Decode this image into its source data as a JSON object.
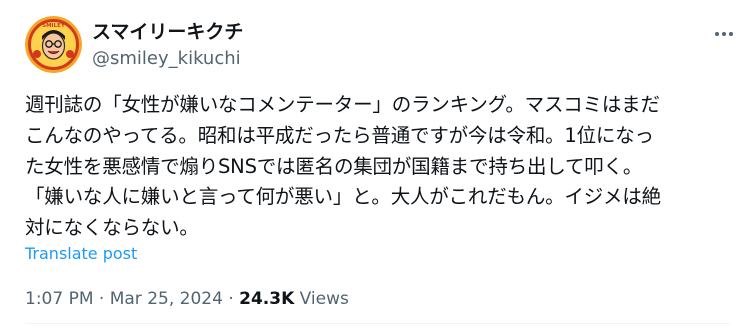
{
  "post": {
    "author_name": "スマイリーキクチ",
    "author_handle": "@smiley_kikuchi",
    "avatar_text": "SMILEY",
    "body_lines": [
      "週刊誌の「女性が嫌いなコメンテーター」のランキング。マスコミはまだ",
      "こんなのやってる。昭和は平成だったら普通ですが今は令和。1位になっ",
      "た女性を悪感情で煽りSNSでは匿名の集団が国籍まで持ち出して叩く。",
      "「嫌いな人に嫌いと言って何が悪い」と。大人がこれだもん。イジメは絶",
      "対になくならない。"
    ],
    "translate_label": "Translate post",
    "time": "1:07 PM",
    "date": "Mar 25, 2024",
    "separator": "·",
    "views_count": "24.3K",
    "views_label": "Views"
  },
  "colors": {
    "text": "#0f1419",
    "secondary": "#536471",
    "link": "#1d9bf0",
    "avatar_bg": "#f5a623"
  },
  "icons": {
    "more": "more-horizontal-icon"
  }
}
